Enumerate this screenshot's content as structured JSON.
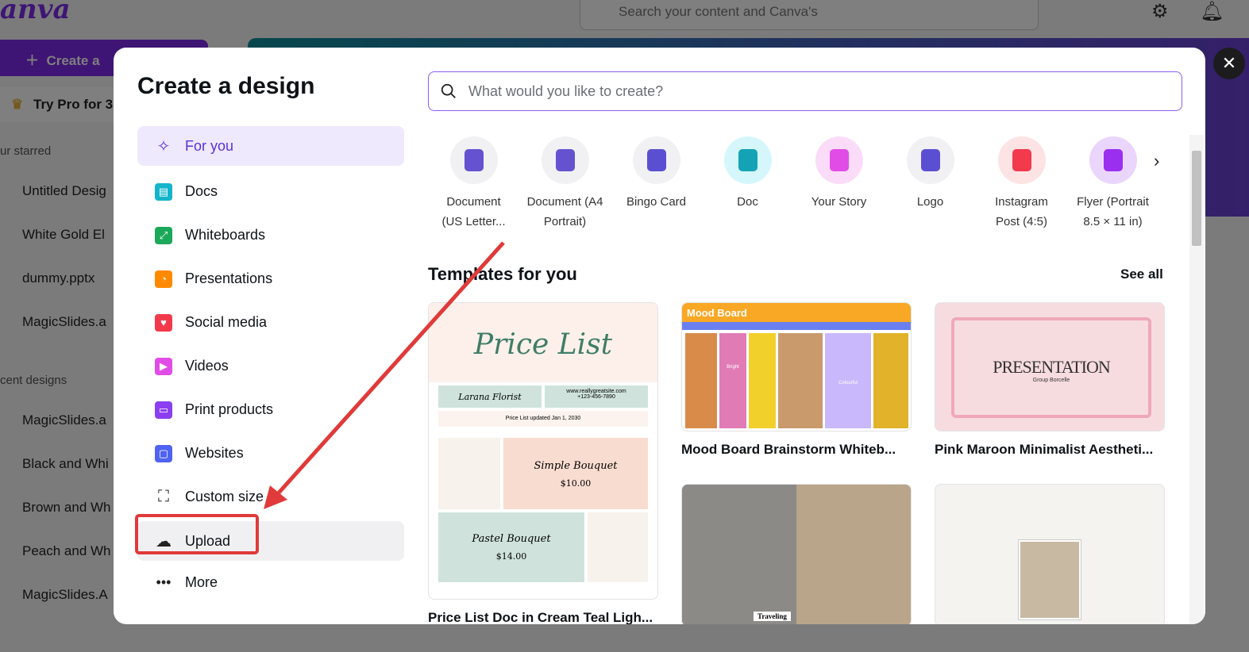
{
  "background": {
    "logo": "anva",
    "create_button": "Create a",
    "try_pro": "Try Pro for 3",
    "starred_heading": "ur starred",
    "starred": [
      "Untitled Desig",
      "White Gold El",
      "dummy.pptx",
      "MagicSlides.a"
    ],
    "recent_heading": "cent designs",
    "recent": [
      "MagicSlides.a",
      "Black and Whi",
      "Brown and Wh",
      "Peach and Wh",
      "MagicSlides.A"
    ],
    "search_placeholder": "Search your content and Canva's"
  },
  "modal": {
    "title": "Create a design",
    "close": "✕",
    "nav": [
      {
        "label": "For you"
      },
      {
        "label": "Docs"
      },
      {
        "label": "Whiteboards"
      },
      {
        "label": "Presentations"
      },
      {
        "label": "Social media"
      },
      {
        "label": "Videos"
      },
      {
        "label": "Print products"
      },
      {
        "label": "Websites"
      },
      {
        "label": "Custom size"
      },
      {
        "label": "Upload"
      },
      {
        "label": "More"
      }
    ],
    "search_placeholder": "What would you like to create?",
    "types": [
      {
        "l1": "Document",
        "l2": "(US Letter...",
        "bg": "#f1f1f4",
        "fg": "#6552d0"
      },
      {
        "l1": "Document (A4",
        "l2": "Portrait)",
        "bg": "#f1f1f4",
        "fg": "#6552d0"
      },
      {
        "l1": "Bingo Card",
        "l2": "",
        "bg": "#f1f1f4",
        "fg": "#5b4fd1"
      },
      {
        "l1": "Doc",
        "l2": "",
        "bg": "#d5f7fb",
        "fg": "#13a3b5"
      },
      {
        "l1": "Your Story",
        "l2": "",
        "bg": "#fadcf8",
        "fg": "#e24ce6"
      },
      {
        "l1": "Logo",
        "l2": "",
        "bg": "#f1f1f4",
        "fg": "#5b4fd1"
      },
      {
        "l1": "Instagram",
        "l2": "Post (4:5)",
        "bg": "#fde3e3",
        "fg": "#f23a4c"
      },
      {
        "l1": "Flyer (Portrait",
        "l2": "8.5 × 11 in)",
        "bg": "#ead6fc",
        "fg": "#9b2ff0"
      }
    ],
    "templates_heading": "Templates for you",
    "see_all": "See all",
    "templates": [
      {
        "caption": "Price List Doc in Cream Teal Ligh...",
        "title": "Price List",
        "florist": "Larana Florist",
        "site": "www.reallygreatsite.com",
        "phone": "+123-456-7890",
        "updated": "Price List updated  Jan 1, 2030",
        "item1": "Simple Bouquet",
        "price1": "$10.00",
        "item2": "Pastel Bouquet",
        "price2": "$14.00"
      },
      {
        "caption": "Mood Board Brainstorm Whiteb...",
        "title": "Mood Board",
        "t1": "Bright",
        "t2": "Colourful"
      },
      {
        "caption": "Pink Maroon Minimalist Aestheti...",
        "title": "PRESENTATION",
        "sub": "Group Borcelle"
      },
      {
        "caption": "",
        "label": "Traveling"
      }
    ]
  }
}
